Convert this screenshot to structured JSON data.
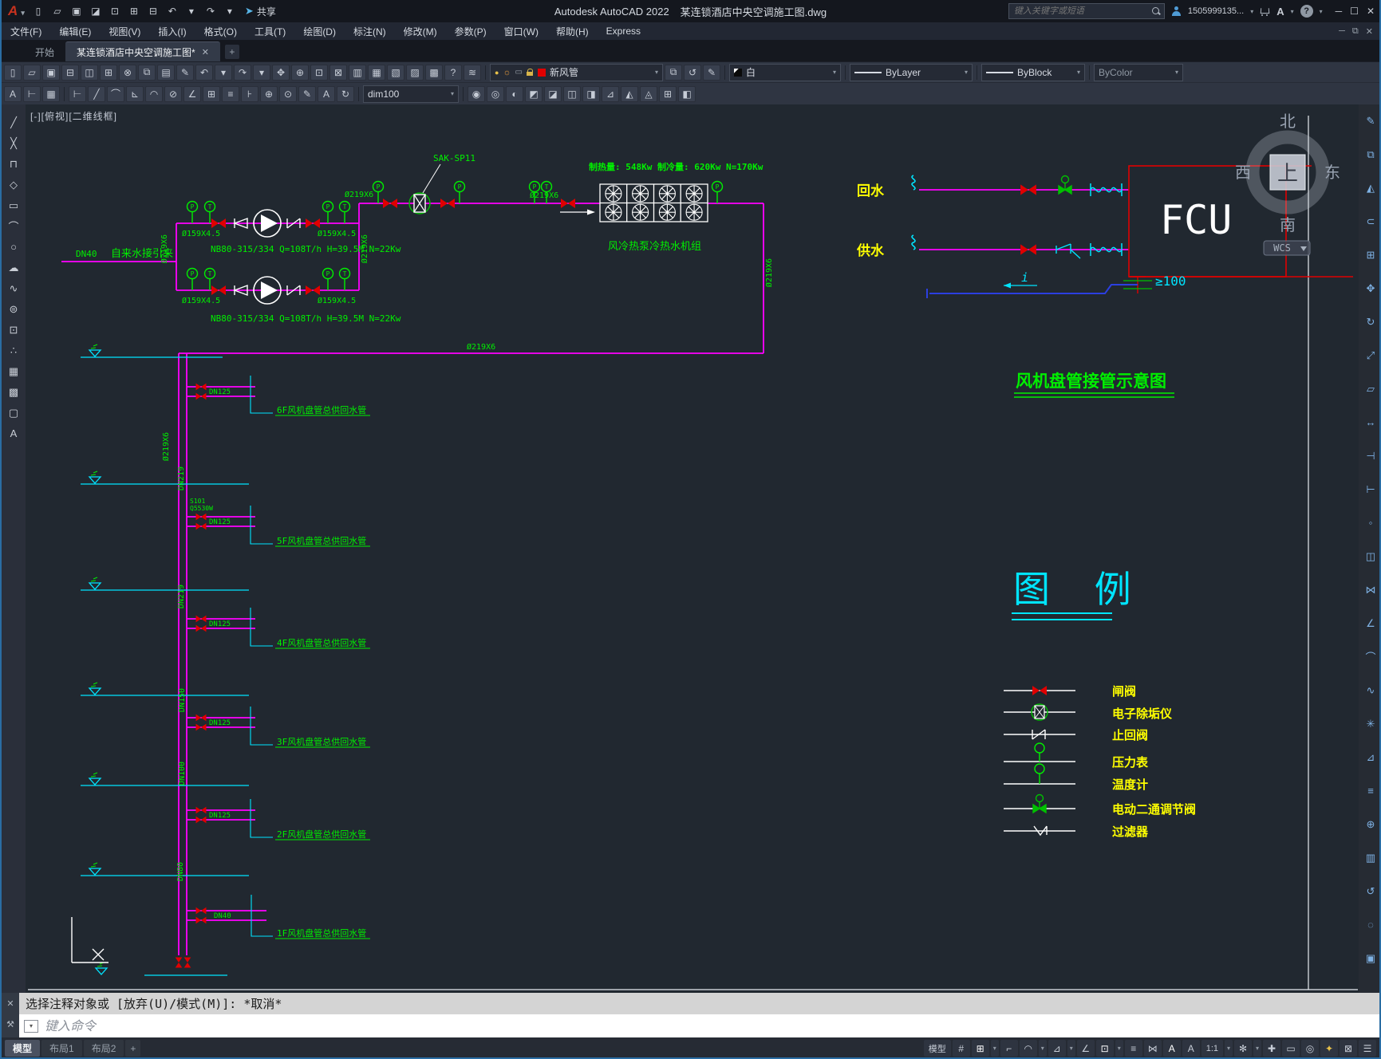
{
  "colors": {
    "pipe": "#ff00ff",
    "annotation": "#00ef00",
    "callout": "#ffff00",
    "cyan": "#00e5ff",
    "valve_red": "#e00000",
    "fcu_red": "#e00000",
    "drain_blue": "#2b3fe0"
  },
  "titlebar": {
    "app_title": "Autodesk AutoCAD 2022",
    "doc_title": "某连锁酒店中央空调施工图.dwg",
    "share_label": "共享",
    "search_placeholder": "键入关键字或短语",
    "account": "1505999135...",
    "quick_icons": [
      [
        "▯",
        "new-file-icon"
      ],
      [
        "▱",
        "open-file-icon"
      ],
      [
        "▣",
        "save-icon"
      ],
      [
        "◪",
        "save-as-icon"
      ],
      [
        "⊡",
        "open-from-web-icon"
      ],
      [
        "⊞",
        "save-to-web-icon"
      ],
      [
        "⊟",
        "plot-icon"
      ],
      [
        "↶",
        "undo-icon"
      ],
      [
        "▾",
        "undo-dropdown-icon"
      ],
      [
        "↷",
        "redo-icon"
      ],
      [
        "▾",
        "redo-dropdown-icon"
      ]
    ]
  },
  "menubar": {
    "items": [
      "文件(F)",
      "编辑(E)",
      "视图(V)",
      "插入(I)",
      "格式(O)",
      "工具(T)",
      "绘图(D)",
      "标注(N)",
      "修改(M)",
      "参数(P)",
      "窗口(W)",
      "帮助(H)",
      "Express"
    ]
  },
  "tabs": {
    "start": "开始",
    "doc": "某连锁酒店中央空调施工图*",
    "close": "✕",
    "new": "+"
  },
  "toolbar1": {
    "left_icons": [
      [
        "▯",
        "qnew-icon"
      ],
      [
        "▱",
        "open-icon"
      ],
      [
        "▣",
        "qsave-icon"
      ],
      [
        "⊟",
        "plot-icon"
      ],
      [
        "◫",
        "plot-preview-icon"
      ],
      [
        "⊞",
        "publish-icon"
      ],
      [
        "⊗",
        "cut-icon"
      ],
      [
        "⧉",
        "copy-clip-icon"
      ],
      [
        "▤",
        "paste-icon"
      ],
      [
        "✎",
        "match-properties-icon"
      ],
      [
        "↶",
        "undo-icon"
      ],
      [
        "▾",
        "undo-dropdown-icon"
      ],
      [
        "↷",
        "redo-icon"
      ],
      [
        "▾",
        "redo-dropdown-icon"
      ],
      [
        "✥",
        "pan-icon"
      ],
      [
        "⊕",
        "zoom-realtime-icon"
      ],
      [
        "⊡",
        "zoom-window-icon"
      ],
      [
        "⊠",
        "zoom-previous-icon"
      ],
      [
        "▥",
        "properties-icon"
      ],
      [
        "▦",
        "designcenter-icon"
      ],
      [
        "▧",
        "tool-palettes-icon"
      ],
      [
        "▨",
        "sheetset-manager-icon"
      ],
      [
        "▩",
        "quickcalc-icon"
      ],
      [
        "?",
        "help-icon"
      ],
      [
        "≋",
        "shared-views-icon"
      ]
    ],
    "layer_bulb": "●",
    "layer_sun": "☼",
    "layer_vp": "▭",
    "layer_name": "新风管",
    "layer_tool_icons": [
      [
        "⧉",
        "make-layer-current-icon"
      ],
      [
        "↺",
        "layer-previous-icon"
      ],
      [
        "✎",
        "layer-states-icon"
      ]
    ],
    "color_name": "白",
    "linetype": "ByLayer",
    "lineweight": "ByBlock",
    "plot_style": "ByColor"
  },
  "toolbar2": {
    "left_icons": [
      [
        "A",
        "text-style-icon"
      ],
      [
        "⊢",
        "dim-style-icon"
      ],
      [
        "▦",
        "table-style-icon"
      ]
    ],
    "dim_icons": [
      [
        "⊢",
        "linear-dim-icon"
      ],
      [
        "╱",
        "aligned-dim-icon"
      ],
      [
        "⌒",
        "arc-length-icon"
      ],
      [
        "⊾",
        "ordinate-dim-icon"
      ],
      [
        "◠",
        "radius-dim-icon"
      ],
      [
        "⊘",
        "diameter-dim-icon"
      ],
      [
        "∠",
        "angular-dim-icon"
      ],
      [
        "⊞",
        "quick-dim-icon"
      ],
      [
        "≡",
        "baseline-dim-icon"
      ],
      [
        "⊦",
        "continue-dim-icon"
      ],
      [
        "⊕",
        "tolerance-icon"
      ],
      [
        "⊙",
        "center-mark-icon"
      ],
      [
        "✎",
        "dim-edit-icon"
      ],
      [
        "A",
        "dim-text-edit-icon"
      ],
      [
        "↻",
        "dim-update-icon"
      ]
    ],
    "dim_style": "dim100",
    "solid_icons": [
      [
        "◉",
        "union-icon"
      ],
      [
        "◎",
        "subtract-icon"
      ],
      [
        "◐",
        "intersect-icon"
      ],
      [
        "◩",
        "extrude-icon"
      ],
      [
        "◪",
        "revolve-icon"
      ],
      [
        "◫",
        "sweep-icon"
      ],
      [
        "◨",
        "loft-icon"
      ],
      [
        "⊿",
        "slice-icon"
      ],
      [
        "◭",
        "section-plane-icon"
      ],
      [
        "◬",
        "interference-icon"
      ],
      [
        "⊞",
        "presspull-icon"
      ],
      [
        "◧",
        "thicken-icon"
      ]
    ]
  },
  "palette": {
    "left_icons": [
      [
        "╱",
        "line-icon"
      ],
      [
        "╳",
        "construction-line-icon"
      ],
      [
        "⊓",
        "polyline-icon"
      ],
      [
        "◇",
        "polygon-icon"
      ],
      [
        "▭",
        "rectangle-icon"
      ],
      [
        "⌒",
        "arc-icon"
      ],
      [
        "○",
        "circle-icon"
      ],
      [
        "☁",
        "revision-cloud-icon"
      ],
      [
        "∿",
        "spline-icon"
      ],
      [
        "⊜",
        "ellipse-icon"
      ],
      [
        "⊡",
        "insert-block-icon"
      ],
      [
        "∴",
        "point-icon"
      ],
      [
        "▦",
        "hatch-icon"
      ],
      [
        "▩",
        "gradient-icon"
      ],
      [
        "▢",
        "region-icon"
      ],
      [
        "A",
        "multiline-text-icon"
      ]
    ],
    "right_icons": [
      [
        "✎",
        "erase-icon"
      ],
      [
        "⧉",
        "copy-icon"
      ],
      [
        "◭",
        "mirror-icon"
      ],
      [
        "⊂",
        "offset-icon"
      ],
      [
        "⊞",
        "array-icon"
      ],
      [
        "✥",
        "move-icon"
      ],
      [
        "↻",
        "rotate-icon"
      ],
      [
        "⤢",
        "scale-icon"
      ],
      [
        "▱",
        "stretch-icon"
      ],
      [
        "↔",
        "lengthen-icon"
      ],
      [
        "⊣",
        "trim-icon"
      ],
      [
        "⊢",
        "extend-icon"
      ],
      [
        "◦",
        "break-at-point-icon"
      ],
      [
        "◫",
        "break-icon"
      ],
      [
        "⋈",
        "join-icon"
      ],
      [
        "∠",
        "chamfer-icon"
      ],
      [
        "⌒",
        "fillet-icon"
      ],
      [
        "∿",
        "blend-curves-icon"
      ],
      [
        "✳",
        "explode-icon"
      ],
      [
        "⊿",
        "measure-icon"
      ],
      [
        "≡",
        "properties-icon"
      ],
      [
        "⊕",
        "ucs-icon"
      ],
      [
        "▥",
        "named-views-icon"
      ],
      [
        "↺",
        "regen-icon"
      ],
      [
        "◌",
        "redraw-icon"
      ],
      [
        "▣",
        "group-icon"
      ]
    ]
  },
  "drawing": {
    "viewport_label": "[-][俯视][二维线框]",
    "inlet_dn": "DN40",
    "inlet_label": "自来水接引来",
    "pipe159": "Ø159X4.5",
    "pipe219": "Ø219X6",
    "pump_spec": "NB80-315/334 Q=108T/h H=39.5M N=22Kw",
    "descaler_tag": "SAK-SP11",
    "gauge_p": "P",
    "gauge_t": "T",
    "unit_capacity": "制热量: 548Kw  制冷量: 620Kw  N=170Kw",
    "unit_label": "风冷热泵冷热水机组",
    "riser_labels": [
      "Ø219X6",
      "DN219",
      "DN219",
      "DN150",
      "DN100",
      "DN80"
    ],
    "branch_note_1": "S101",
    "branch_note_2": "Q5530W",
    "branches": [
      {
        "dn": "DN125",
        "label": "6F风机盘管总供回水管"
      },
      {
        "dn": "DN125",
        "label": "5F风机盘管总供回水管"
      },
      {
        "dn": "DN125",
        "label": "4F风机盘管总供回水管"
      },
      {
        "dn": "DN125",
        "label": "3F风机盘管总供回水管"
      },
      {
        "dn": "DN125",
        "label": "2F风机盘管总供回水管"
      },
      {
        "dn": "DN40",
        "label": "1F风机盘管总供回水管"
      }
    ],
    "fcu": {
      "return_label": "回水",
      "supply_label": "供水",
      "box_label": "FCU",
      "clearance": "≥100",
      "slope": "i",
      "schematic_title": "风机盘管接管示意图"
    },
    "legend": {
      "title": "图 例",
      "items": [
        {
          "label": "闸阀"
        },
        {
          "label": "电子除垢仪"
        },
        {
          "label": "止回阀"
        },
        {
          "label": "压力表"
        },
        {
          "label": "温度计"
        },
        {
          "label": "电动二通调节阀"
        },
        {
          "label": "过滤器"
        }
      ]
    }
  },
  "viewcube": {
    "north": "北",
    "south": "南",
    "east": "东",
    "west": "西",
    "top": "上",
    "wcs": "WCS"
  },
  "command": {
    "history": "选择注释对象或 [放弃(U)/模式(M)]: *取消*",
    "input_placeholder": "键入命令",
    "gutter_icons": [
      [
        "✕",
        "close-command-icon"
      ],
      [
        "⚒",
        "customize-command-icon"
      ]
    ]
  },
  "statusbar": {
    "tabs": [
      "模型",
      "布局1",
      "布局2"
    ],
    "new_layout_label": "+",
    "right_icons": [
      [
        "模型",
        "model-space-button",
        "txt"
      ],
      [
        "#",
        "grid-display-icon"
      ],
      [
        "⊞",
        "snap-mode-icon",
        "hl"
      ],
      [
        "▾",
        "snap-arrow-icon",
        "arr"
      ],
      [
        "⌐",
        "ortho-icon"
      ],
      [
        "◠",
        "polar-tracking-icon"
      ],
      [
        "▾",
        "polar-arrow-icon",
        "arr"
      ],
      [
        "⊿",
        "isodraft-icon"
      ],
      [
        "▾",
        "isodraft-arrow-icon",
        "arr"
      ],
      [
        "∠",
        "osnap-tracking-icon"
      ],
      [
        "⊡",
        "osnap-icon",
        "hl"
      ],
      [
        "▾",
        "osnap-arrow-icon",
        "arr"
      ],
      [
        "≡",
        "lineweight-display-icon"
      ],
      [
        "⋈",
        "selection-cycling-icon"
      ],
      [
        "A",
        "annotation-visibility-icon",
        "hl"
      ],
      [
        "A",
        "autoscale-icon"
      ],
      [
        "1:1",
        "annotation-scale-button",
        "txt"
      ],
      [
        "▾",
        "annoscale-arrow-icon",
        "arr"
      ],
      [
        "✻",
        "workspace-switching-icon"
      ],
      [
        "▾",
        "workspace-arrow-icon",
        "arr"
      ],
      [
        "✚",
        "annotation-monitor-icon"
      ],
      [
        "▭",
        "units-icon"
      ],
      [
        "◎",
        "isolate-objects-icon"
      ],
      [
        "✦",
        "graphics-performance-icon",
        "yl"
      ],
      [
        "⊠",
        "clean-screen-icon"
      ],
      [
        "☰",
        "customize-icon"
      ]
    ]
  }
}
